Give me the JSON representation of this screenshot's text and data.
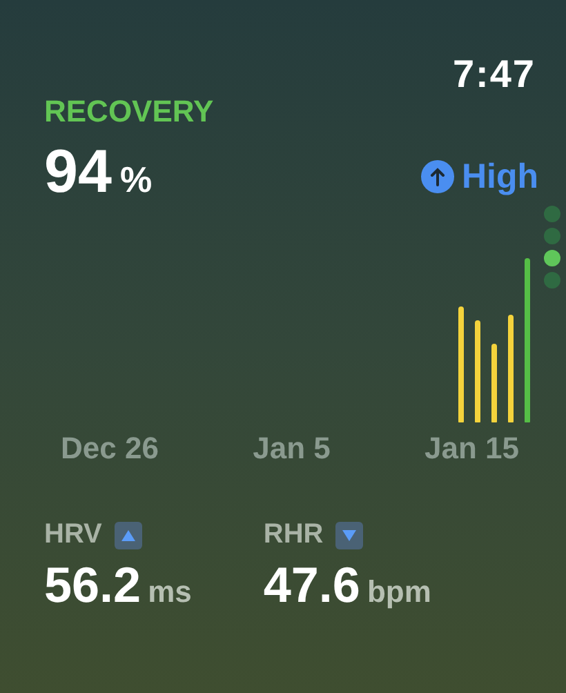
{
  "time": "7:47",
  "recovery": {
    "title": "RECOVERY",
    "value": "94",
    "unit": "%",
    "status": {
      "label": "High",
      "kind": "up"
    }
  },
  "pages": [
    {
      "selected": false
    },
    {
      "selected": false
    },
    {
      "selected": true
    },
    {
      "selected": false
    }
  ],
  "chart_axis": [
    "Dec 26",
    "Jan 5",
    "Jan 15"
  ],
  "metrics": [
    {
      "label": "HRV",
      "kind": "up",
      "value": "56.2",
      "unit": "ms"
    },
    {
      "label": "RHR",
      "kind": "down",
      "value": "47.6",
      "unit": "bpm"
    }
  ]
}
